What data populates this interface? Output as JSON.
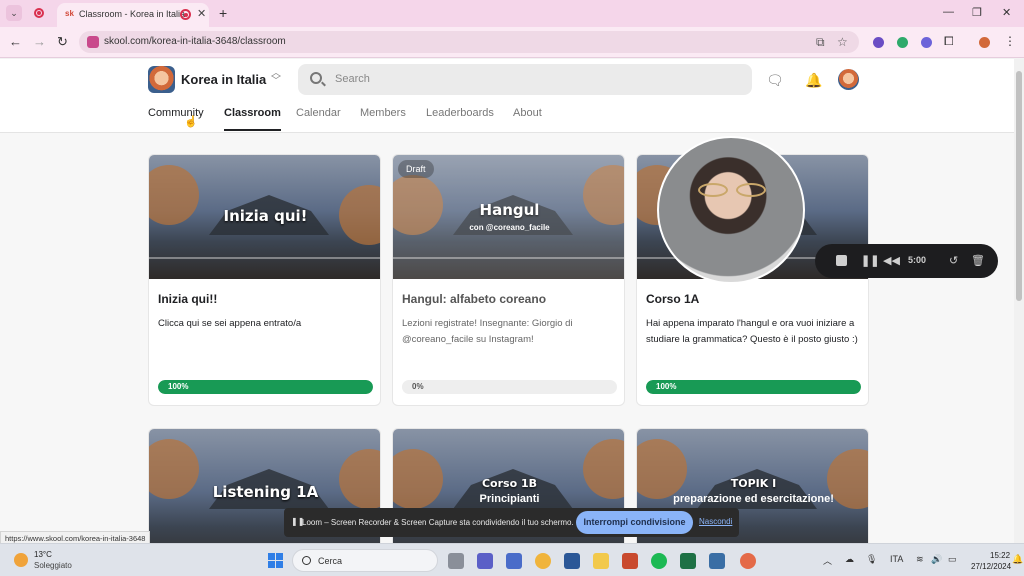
{
  "browser": {
    "tab_title": "Classroom - Korea in Italia",
    "tab_favicon": "sk",
    "url": "skool.com/korea-in-italia-3648/classroom",
    "status_url": "https://www.skool.com/korea-in-italia-3648"
  },
  "header": {
    "group_name": "Korea in Italia",
    "search_placeholder": "Search",
    "nav": [
      "Community",
      "Classroom",
      "Calendar",
      "Members",
      "Leaderboards",
      "About"
    ],
    "active_nav": "Classroom"
  },
  "courses": [
    {
      "image_title": "Inizia qui!",
      "image_subtitle": "",
      "badge": "",
      "title": "Inizia qui!!",
      "description": "Clicca qui se sei appena entrato/a",
      "progress": 100,
      "progress_label": "100%"
    },
    {
      "image_title": "Hangul",
      "image_subtitle": "con @coreano_facile",
      "badge": "Draft",
      "title": "Hangul: alfabeto coreano",
      "description": "Lezioni registrate! Insegnante: Giorgio di @coreano_facile su Instagram!",
      "progress": 0,
      "progress_label": "0%"
    },
    {
      "image_title": "",
      "image_subtitle": "",
      "badge": "",
      "title": "Corso 1A",
      "description": "Hai appena imparato l'hangul e ora vuoi iniziare a studiare la grammatica? Questo è il posto giusto :)",
      "progress": 100,
      "progress_label": "100%"
    },
    {
      "image_title": "Listening 1A",
      "image_subtitle": ""
    },
    {
      "image_title": "Corso 1B",
      "image_subtitle": "Principianti"
    },
    {
      "image_title": "TOPIK I",
      "image_subtitle": "preparazione ed esercitazione!"
    }
  ],
  "loom": {
    "timer": "5:00",
    "share_message": "Loom – Screen Recorder & Screen Capture sta condividendo il tuo schermo.",
    "stop_label": "Interrompi condivisione",
    "hide_label": "Nascondi"
  },
  "taskbar": {
    "temperature": "13°C",
    "weather": "Soleggiato",
    "search_label": "Cerca",
    "language": "ITA",
    "time": "15:22",
    "date": "27/12/2024"
  },
  "colors": {
    "progress_green": "#189a55",
    "tab_bar": "#f5d6ea",
    "share_button": "#8ab4f8"
  }
}
